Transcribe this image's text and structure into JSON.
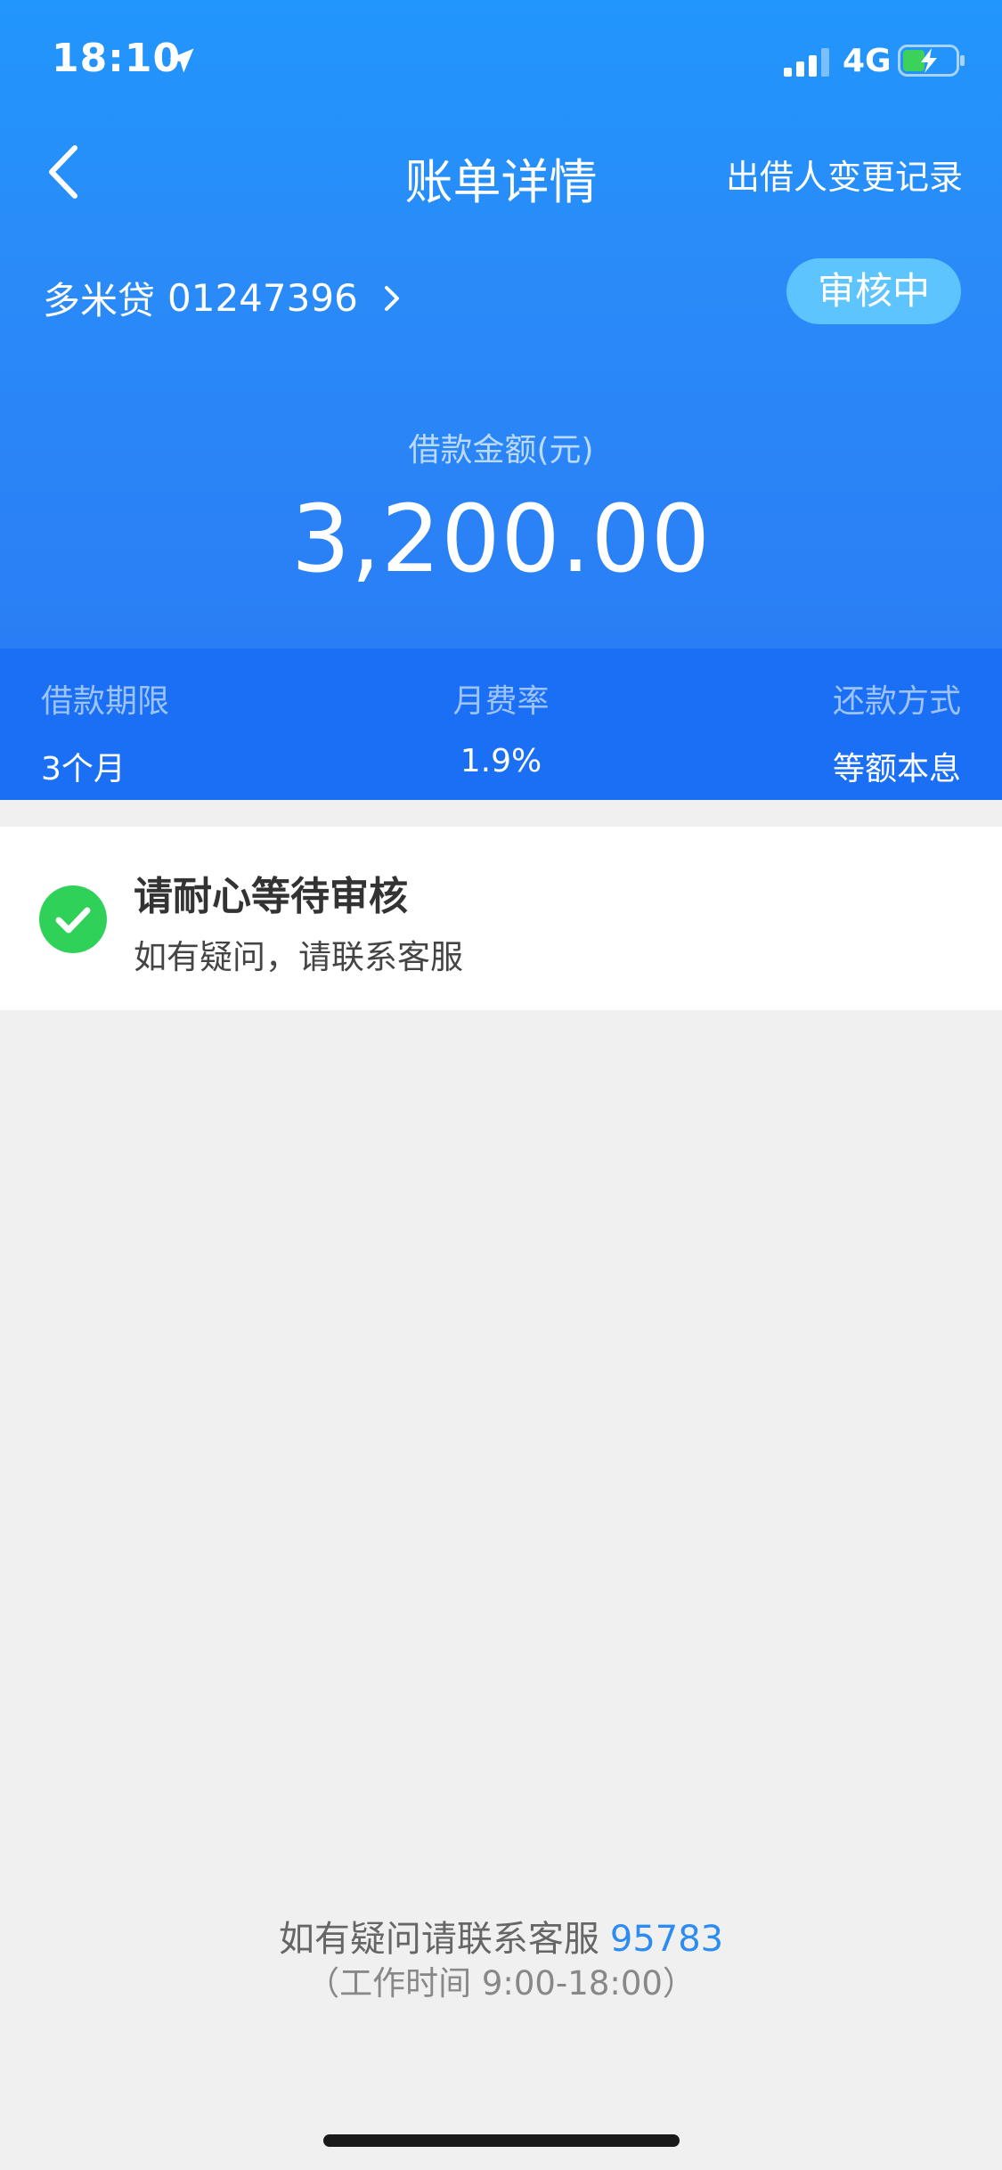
{
  "status_bar": {
    "time": "18:10",
    "network": "4G",
    "icons": [
      "location-arrow-icon",
      "signal-icon",
      "battery-charging-icon"
    ]
  },
  "nav": {
    "title": "账单详情",
    "right_label": "出借人变更记录",
    "back_icon": "chevron-left-icon"
  },
  "loan": {
    "name": "多米贷",
    "number": "01247396",
    "status": "审核中"
  },
  "amount": {
    "label": "借款金额(元)",
    "value": "3,200.00"
  },
  "details": [
    {
      "label": "借款期限",
      "value": "3个月"
    },
    {
      "label": "月费率",
      "value": "1.9%"
    },
    {
      "label": "还款方式",
      "value": "等额本息"
    }
  ],
  "notice": {
    "title": "请耐心等待审核",
    "subtitle": "如有疑问，请联系客服",
    "icon": "check-circle-icon"
  },
  "footer": {
    "contact_text": "如有疑问请联系客服",
    "phone": "95783",
    "hours": "（工作时间 9:00-18:00）"
  },
  "colors": {
    "header_top": "#2196fc",
    "info_strip": "#1b6ff5",
    "badge": "#5ec4fd",
    "success": "#2fd158",
    "link": "#2d8cf0",
    "page_bg": "#f0f0f0"
  }
}
